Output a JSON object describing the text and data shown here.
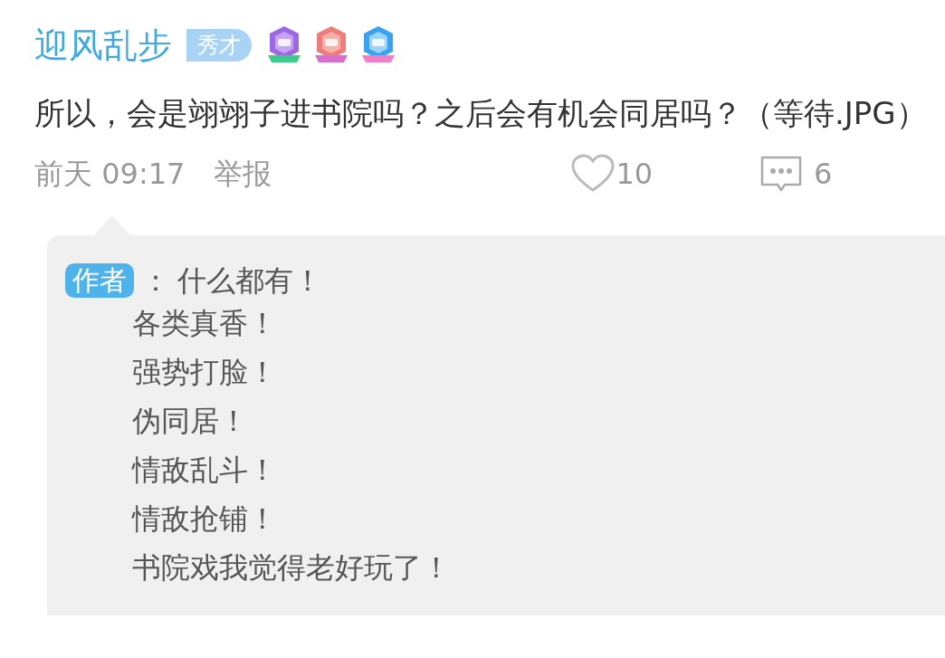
{
  "post": {
    "username": "迎风乱步",
    "rank": "秀才",
    "text": "所以，会是翊翊子进书院吗？之后会有机会同居吗？（等待.JPG）",
    "time": "前天 09:17",
    "report": "举报",
    "likes": "10",
    "comments": "6"
  },
  "reply": {
    "tag": "作者",
    "separator": "：",
    "lines": [
      "什么都有！",
      "各类真香！",
      "强势打脸！",
      "伪同居！",
      "情敌乱斗！",
      "情敌抢铺！",
      "书院戏我觉得老好玩了！"
    ]
  }
}
